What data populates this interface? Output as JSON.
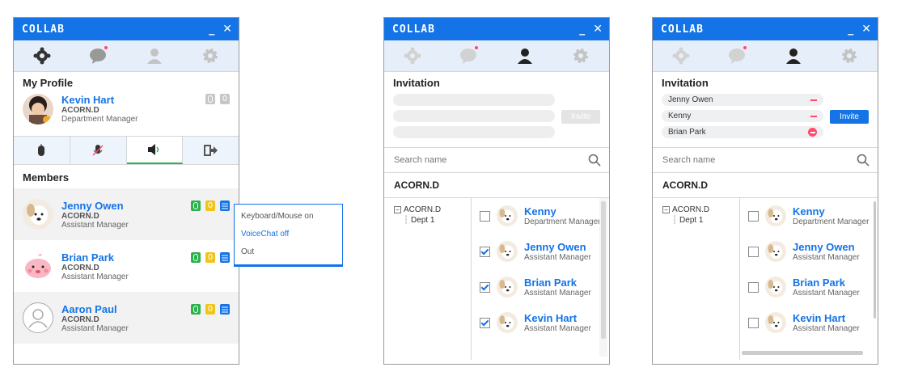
{
  "app": {
    "logo": "COLLAB",
    "minimize": "_",
    "close": "✕"
  },
  "panel1": {
    "section_profile": "My Profile",
    "profile": {
      "name": "Kevin Hart",
      "org": "ACORN.D",
      "title": "Department Manager"
    },
    "section_members": "Members",
    "members": [
      {
        "name": "Jenny Owen",
        "org": "ACORN.D",
        "title": "Assistant Manager"
      },
      {
        "name": "Brian Park",
        "org": "ACORN.D",
        "title": "Assistant Manager"
      },
      {
        "name": "Aaron Paul",
        "org": "ACORN.D",
        "title": "Assistant Manager"
      }
    ],
    "popup": [
      "Keyboard/Mouse on",
      "VoiceChat off",
      "Out"
    ]
  },
  "panel2": {
    "section_invitation": "Invitation",
    "invite_button": "Invite",
    "search_placeholder": "Search name",
    "org": "ACORN.D",
    "tree": {
      "root": "ACORN.D",
      "child": "Dept 1"
    },
    "users": [
      {
        "name": "Kenny",
        "title": "Department Manager",
        "checked": false
      },
      {
        "name": "Jenny Owen",
        "title": "Assistant Manager",
        "checked": true
      },
      {
        "name": "Brian Park",
        "title": "Assistant Manager",
        "checked": true
      },
      {
        "name": "Kevin Hart",
        "title": "Assistant Manager",
        "checked": true
      }
    ]
  },
  "panel3": {
    "section_invitation": "Invitation",
    "invitees": [
      "Jenny Owen",
      "Kenny",
      "Brian Park"
    ],
    "invite_button": "Invite",
    "search_placeholder": "Search name",
    "org": "ACORN.D",
    "tree": {
      "root": "ACORN.D",
      "child": "Dept 1"
    },
    "users": [
      {
        "name": "Kenny",
        "title": "Department Manager",
        "checked": false
      },
      {
        "name": "Jenny Owen",
        "title": "Assistant Manager",
        "checked": false
      },
      {
        "name": "Brian Park",
        "title": "Assistant Manager",
        "checked": false
      },
      {
        "name": "Kevin Hart",
        "title": "Assistant Manager",
        "checked": false
      }
    ]
  },
  "colors": {
    "brand": "#1473e6",
    "active": "#2ab24b",
    "warn": "#ff4a6b",
    "accent_yellow": "#f0c419"
  }
}
